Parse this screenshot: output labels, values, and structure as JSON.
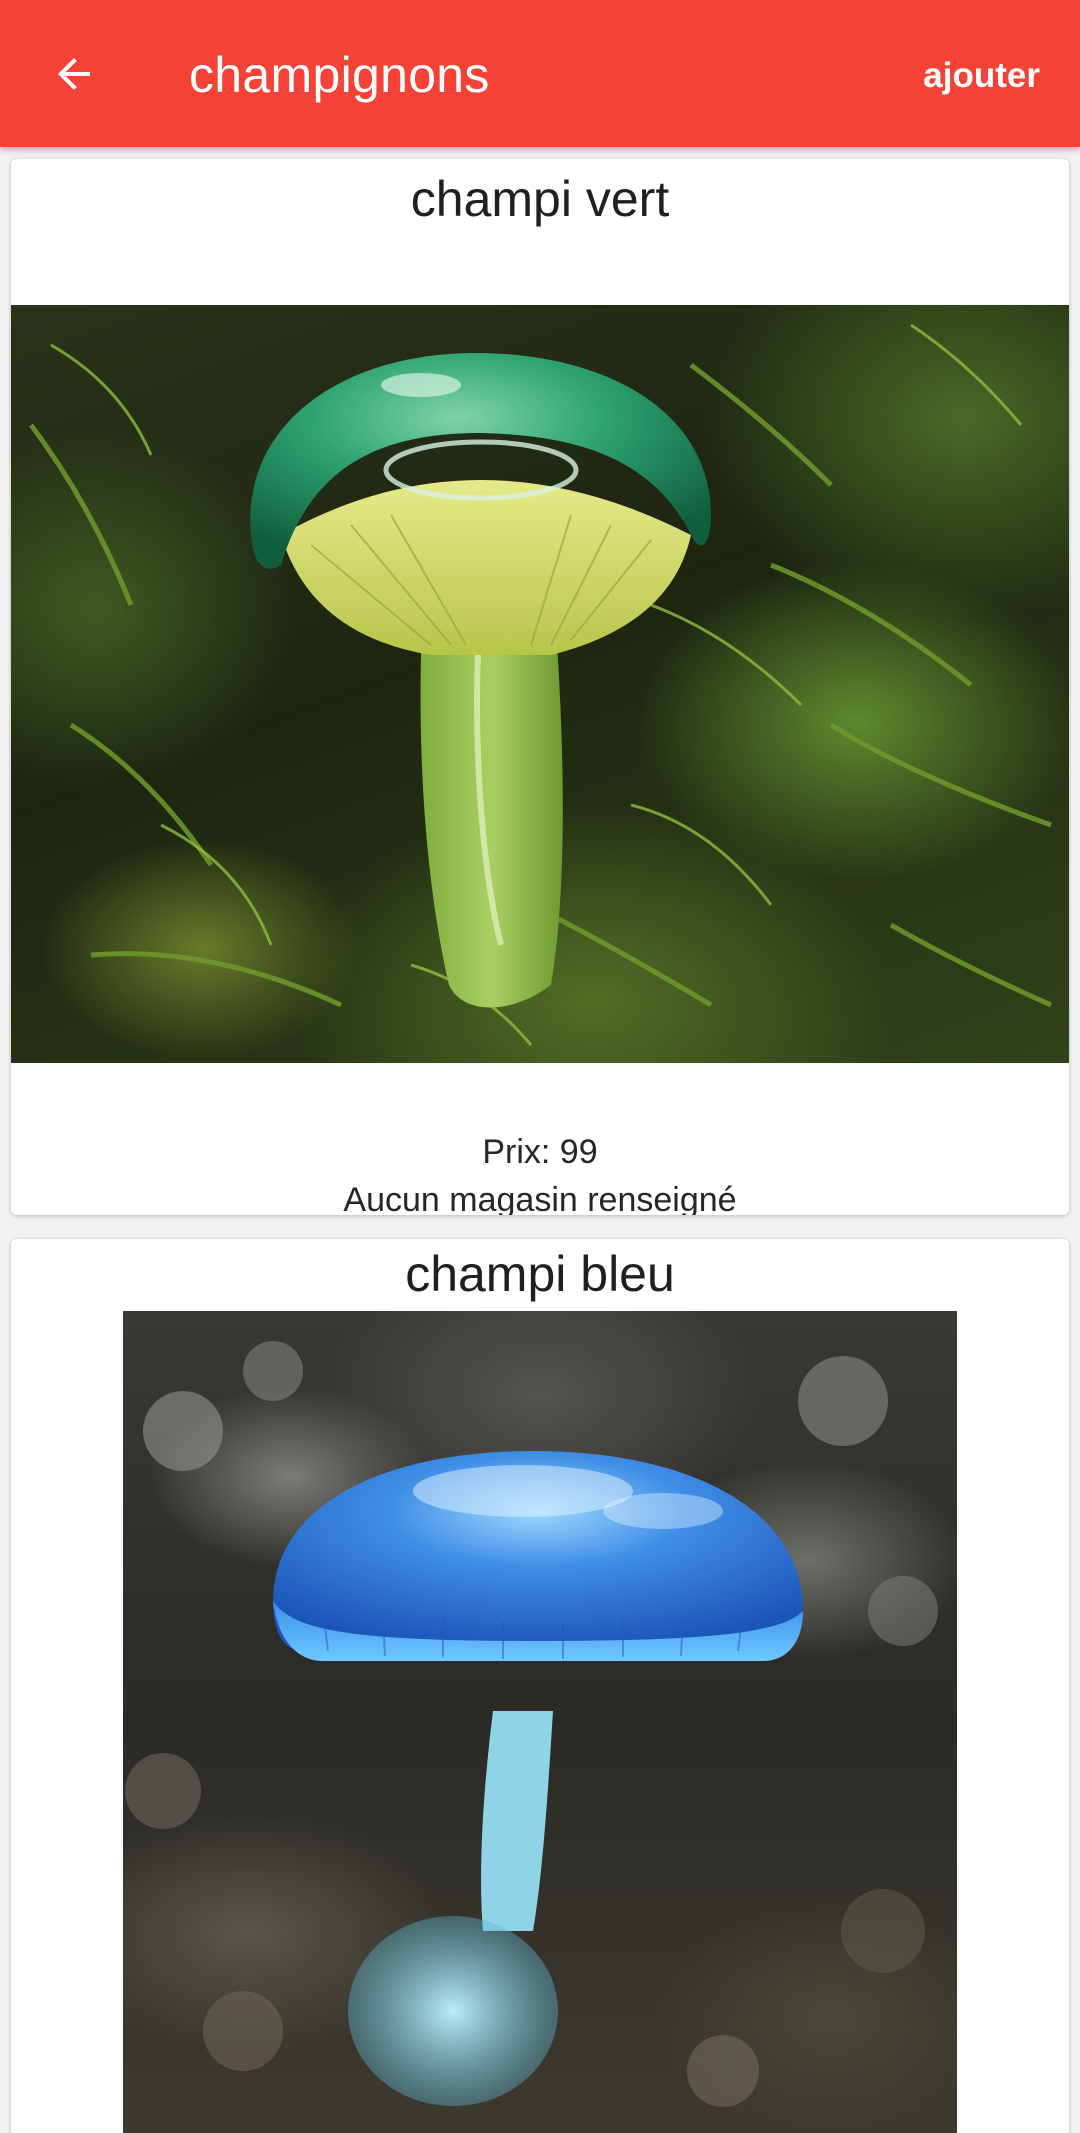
{
  "app_bar": {
    "title": "champignons",
    "back_icon": "arrow-back-icon",
    "add_label": "ajouter",
    "color": "#f44336"
  },
  "items": [
    {
      "name": "champi vert",
      "price_text": "Prix: 99",
      "store_text": "Aucun magasin renseigné",
      "photo_subject": "green mushroom on moss"
    },
    {
      "name": "champi bleu",
      "photo_subject": "blue mushroom"
    }
  ]
}
